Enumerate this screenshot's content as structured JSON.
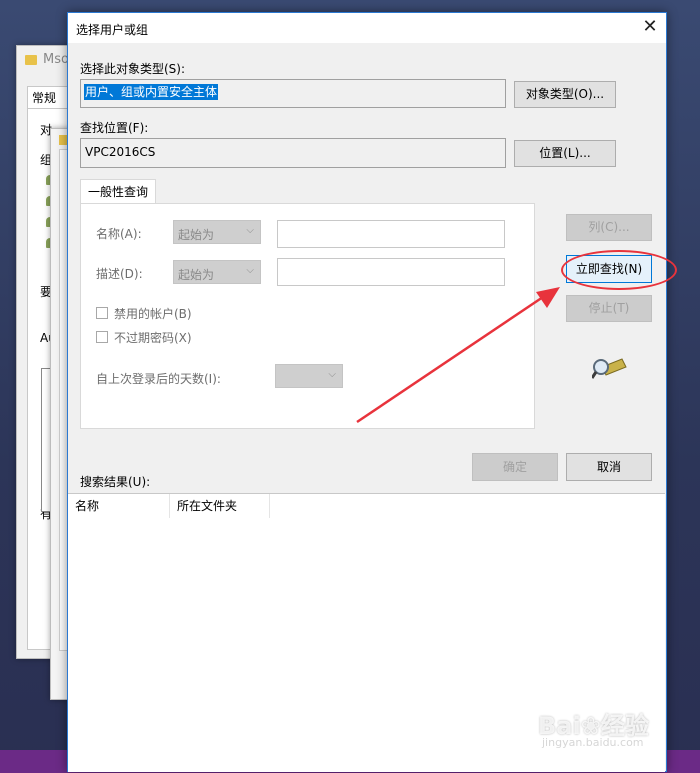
{
  "background": {
    "window1": {
      "title": "Mso",
      "tab": "常规",
      "labels": [
        "对",
        "组",
        "要",
        "Au",
        "有"
      ]
    }
  },
  "dialog": {
    "title": "选择用户或组",
    "close": "✕",
    "object_type_label": "选择此对象类型(S):",
    "object_type_value": "用户、组或内置安全主体",
    "object_type_button": "对象类型(O)...",
    "location_label": "查找位置(F):",
    "location_value": "VPC2016CS",
    "location_button": "位置(L)...",
    "tab_label": "一般性查询",
    "name_label": "名称(A):",
    "name_mode": "起始为",
    "desc_label": "描述(D):",
    "desc_mode": "起始为",
    "disabled_accounts": "禁用的帐户(B)",
    "non_expiring_pwd": "不过期密码(X)",
    "days_since_login": "自上次登录后的天数(I):",
    "columns_button": "列(C)...",
    "find_now_button": "立即查找(N)",
    "stop_button": "停止(T)",
    "ok_button": "确定",
    "cancel_button": "取消",
    "results_label": "搜索结果(U):",
    "results_columns": [
      "名称",
      "所在文件夹"
    ]
  },
  "watermark": {
    "brand": "Bai❀经验",
    "url": "jingyan.baidu.com"
  },
  "colors": {
    "selection": "#0078d7",
    "annotation": "#e8333c",
    "titlebar_border": "#2b79d2"
  }
}
